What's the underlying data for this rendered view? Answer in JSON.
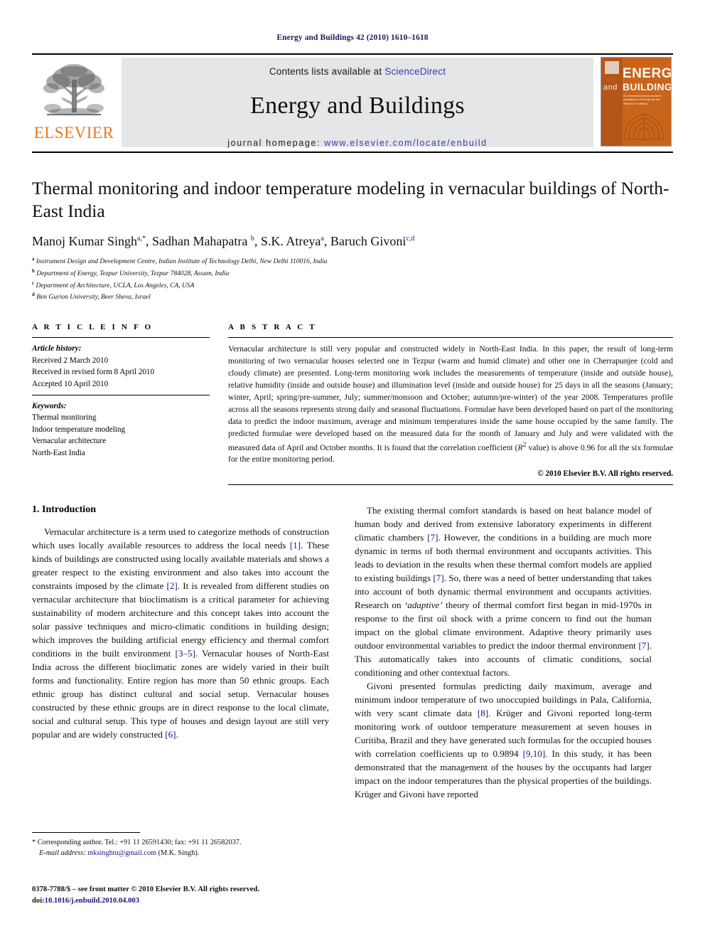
{
  "running_head": "Energy and Buildings 42 (2010) 1610–1618",
  "banner": {
    "contents_prefix": "Contents lists available at ",
    "contents_link": "ScienceDirect",
    "journal_title": "Energy and Buildings",
    "homepage_prefix": "journal homepage: ",
    "homepage_url": "www.elsevier.com/locate/enbuild",
    "publisher_wordmark": "ELSEVIER",
    "cover": {
      "line_and": "and",
      "line_energy": "ENERGY",
      "line_buildings": "BUILDINGS",
      "subtitle": "An international journal devoted to investigations of energy use and efficiency in buildings"
    }
  },
  "article": {
    "title": "Thermal monitoring and indoor temperature modeling in vernacular buildings of North-East India",
    "authors_html": "Manoj Kumar Singh<sup>a,*</sup>, Sadhan Mahapatra <sup>b</sup>, S.K. Atreya<sup>a</sup>, Baruch Givoni<sup>c,d</sup>",
    "affiliations": [
      {
        "marker": "a",
        "text": "Instrument Design and Development Centre, Indian Institute of Technology Delhi, New Delhi 110016, India"
      },
      {
        "marker": "b",
        "text": "Department of Energy, Tezpur University, Tezpur 784028, Assam, India"
      },
      {
        "marker": "c",
        "text": "Department of Architecture, UCLA, Los Angeles, CA, USA"
      },
      {
        "marker": "d",
        "text": "Ben Gurion University, Beer Sheva, Israel"
      }
    ]
  },
  "article_info": {
    "heading": "A R T I C L E   I N F O",
    "history_label": "Article history:",
    "history": [
      "Received 2 March 2010",
      "Received in revised form 8 April 2010",
      "Accepted 10 April 2010"
    ],
    "keywords_label": "Keywords:",
    "keywords": [
      "Thermal monitoring",
      "Indoor temperature modeling",
      "Vernacular architecture",
      "North-East India"
    ]
  },
  "abstract": {
    "heading": "A B S T R A C T",
    "text": "Vernacular architecture is still very popular and constructed widely in North-East India. In this paper, the result of long-term monitoring of two vernacular houses selected one in Tezpur (warm and humid climate) and other one in Cherrapunjee (cold and cloudy climate) are presented. Long-term monitoring work includes the measurements of temperature (inside and outside house), relative humidity (inside and outside house) and illumination level (inside and outside house) for 25 days in all the seasons (January; winter, April; spring/pre-summer, July; summer/monsoon and October; autumn/pre-winter) of the year 2008. Temperatures profile across all the seasons represents strong daily and seasonal fluctuations. Formulae have been developed based on part of the monitoring data to predict the indoor maximum, average and minimum temperatures inside the same house occupied by the same family. The predicted formulae were developed based on the measured data for the month of January and July and were validated with the measured data of April and October months. It is found that the correlation coefficient (R2 value) is above 0.96 for all the six formulae for the entire monitoring period.",
    "copyright": "© 2010 Elsevier B.V. All rights reserved."
  },
  "sections": {
    "intro_heading": "1. Introduction"
  },
  "footnote": {
    "corresponding": "* Corresponding author. Tel.: +91 11 26591430; fax: +91 11 26582037.",
    "email_label": "E-mail address:",
    "email": "mksinghtu@gmail.com",
    "email_owner": "(M.K. Singh)."
  },
  "imprint": {
    "line1": "0378-7788/$ – see front matter © 2010 Elsevier B.V. All rights reserved.",
    "doi_label": "doi:",
    "doi": "10.1016/j.enbuild.2010.04.003"
  },
  "colors": {
    "link": "#16167e",
    "elsevier_orange": "#E87722",
    "running_head": "#1a1a5e",
    "banner_gray": "#e4e6e8"
  }
}
